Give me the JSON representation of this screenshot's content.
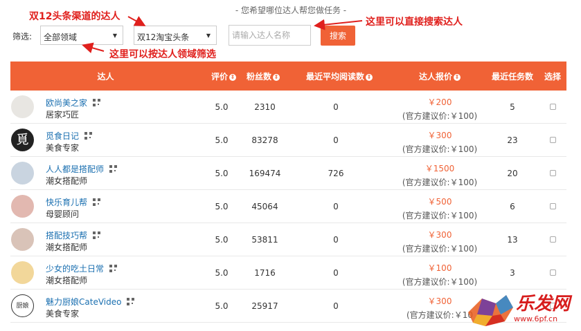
{
  "hint": "- 您希望哪位达人帮您做任务 -",
  "filter": {
    "label": "筛选:",
    "domain_select": "全部领域",
    "channel_select": "双12淘宝头条",
    "search_placeholder": "请输入达人名称",
    "search_button": "搜索"
  },
  "annotations": {
    "channel": "双12头条渠道的达人",
    "search": "这里可以直接搜索达人",
    "domain": "这里可以按达人领域筛选"
  },
  "table": {
    "headers": {
      "talent": "达人",
      "rating": "评价",
      "fans": "粉丝数",
      "avg_reads": "最近平均阅读数",
      "price": "达人报价",
      "tasks": "最近任务数",
      "select": "选择"
    },
    "rows": [
      {
        "name": "欧尚美之家",
        "category": "居家巧匠",
        "rating": "5.0",
        "fans": "2310",
        "reads": "0",
        "price": "￥200",
        "suggest": "(官方建议价:￥100)",
        "tasks": "5"
      },
      {
        "name": "觅食日记",
        "category": "美食专家",
        "rating": "5.0",
        "fans": "83278",
        "reads": "0",
        "price": "￥300",
        "suggest": "(官方建议价:￥100)",
        "tasks": "23"
      },
      {
        "name": "人人都是搭配师",
        "category": "潮女搭配师",
        "rating": "5.0",
        "fans": "169474",
        "reads": "726",
        "price": "￥1500",
        "suggest": "(官方建议价:￥100)",
        "tasks": "20"
      },
      {
        "name": "快乐育儿帮",
        "category": "母婴顾问",
        "rating": "5.0",
        "fans": "45064",
        "reads": "0",
        "price": "￥500",
        "suggest": "(官方建议价:￥100)",
        "tasks": "6"
      },
      {
        "name": "搭配技巧帮",
        "category": "潮女搭配师",
        "rating": "5.0",
        "fans": "53811",
        "reads": "0",
        "price": "￥300",
        "suggest": "(官方建议价:￥100)",
        "tasks": "13"
      },
      {
        "name": "少女的吃土日常",
        "category": "潮女搭配师",
        "rating": "5.0",
        "fans": "1716",
        "reads": "0",
        "price": "￥100",
        "suggest": "(官方建议价:￥100)",
        "tasks": "3"
      },
      {
        "name": "魅力厨娘CateVideo",
        "category": "美食专家",
        "rating": "5.0",
        "fans": "25917",
        "reads": "0",
        "price": "￥300",
        "suggest": "(官方建议价:￥10",
        "tasks": ""
      }
    ]
  },
  "watermark": {
    "brand": "乐发网",
    "url": "www.6pf.cn"
  },
  "colors": {
    "accent": "#f06236",
    "annotation": "#e0201d",
    "link": "#1a6fb0"
  }
}
